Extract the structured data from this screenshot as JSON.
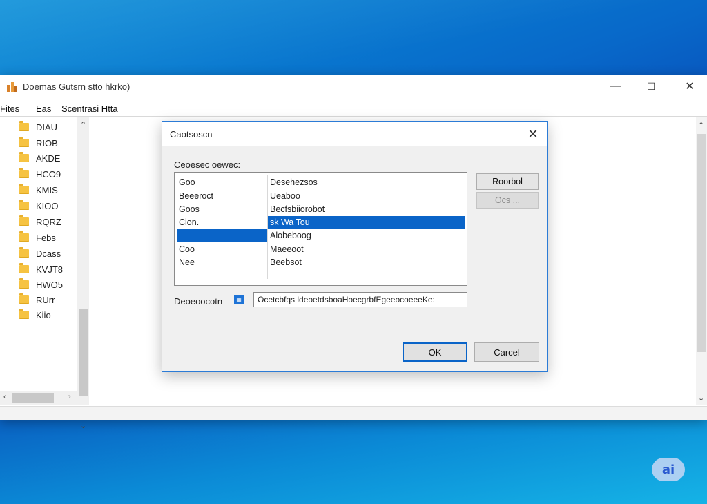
{
  "window": {
    "title": "Doemas Gutsrn stto hkrko)",
    "controls": {
      "minimize": "—",
      "maximize": "☐",
      "close": "✕"
    }
  },
  "menubar": {
    "items": [
      "Fites",
      "Eas",
      "Scentrasi Htta"
    ]
  },
  "tree": {
    "items": [
      "DIAU",
      "RIOB",
      "AKDE",
      "HCO9",
      "KMIS",
      "KIOO",
      "RQRZ",
      "Febs",
      "Dcass",
      "KVJT8",
      "HWO5",
      "RUrr",
      "Kiio"
    ]
  },
  "dialog": {
    "title": "Caotsoscn",
    "close": "✕",
    "group_label": "Ceoesec oewec:",
    "list_rows": [
      {
        "c1": "Goo",
        "c2": "Desehezsos"
      },
      {
        "c1": "Beeeroct",
        "c2": "Ueaboo"
      },
      {
        "c1": "Goos",
        "c2": "Becfsbiiorobot"
      },
      {
        "c1": "Cion.",
        "c2": "sk Wa Tou"
      },
      {
        "c1": "",
        "c2": "Alobeboog"
      },
      {
        "c1": "Coo",
        "c2": "Maeeoot"
      },
      {
        "c1": "Nee",
        "c2": "Beebsot"
      }
    ],
    "selected": {
      "c2_row": 3,
      "c1_row": 4
    },
    "side_buttons": {
      "primary": "Roorbol",
      "secondary": "Ocs ..."
    },
    "field_label": "Deoeoocotn",
    "field_icon": "info",
    "field_value": "Ocetcbfqs ldeoetdsboaHoecgrbfEgeeocoeeeKe:",
    "ok": "OK",
    "cancel": "Carcel"
  },
  "badge": "ai"
}
